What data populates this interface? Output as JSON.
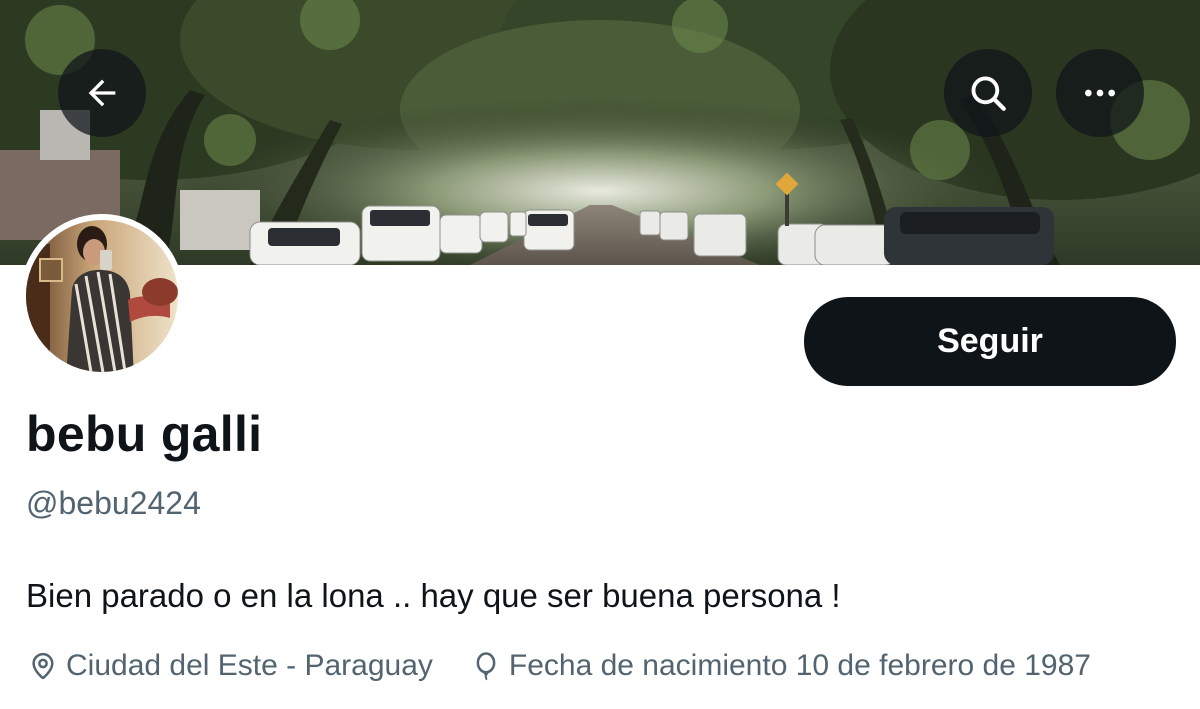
{
  "header": {
    "back_icon": "arrow-left-icon",
    "search_icon": "search-icon",
    "more_icon": "more-horizontal-icon",
    "banner_description": "tree-lined street with parked cars"
  },
  "profile": {
    "display_name": "bebu galli",
    "handle": "@bebu2424",
    "bio": "Bien parado o en la lona .. hay que ser buena persona !",
    "follow_label": "Seguir",
    "location": "Ciudad del Este - Paraguay",
    "location_icon": "location-pin-icon",
    "birthday": "Fecha de nacimiento 10 de febrero de 1987",
    "birthday_icon": "balloon-icon"
  },
  "colors": {
    "text_primary": "#0f1419",
    "text_secondary": "#536471",
    "follow_button_bg": "#0f1419",
    "follow_button_text": "#ffffff"
  }
}
